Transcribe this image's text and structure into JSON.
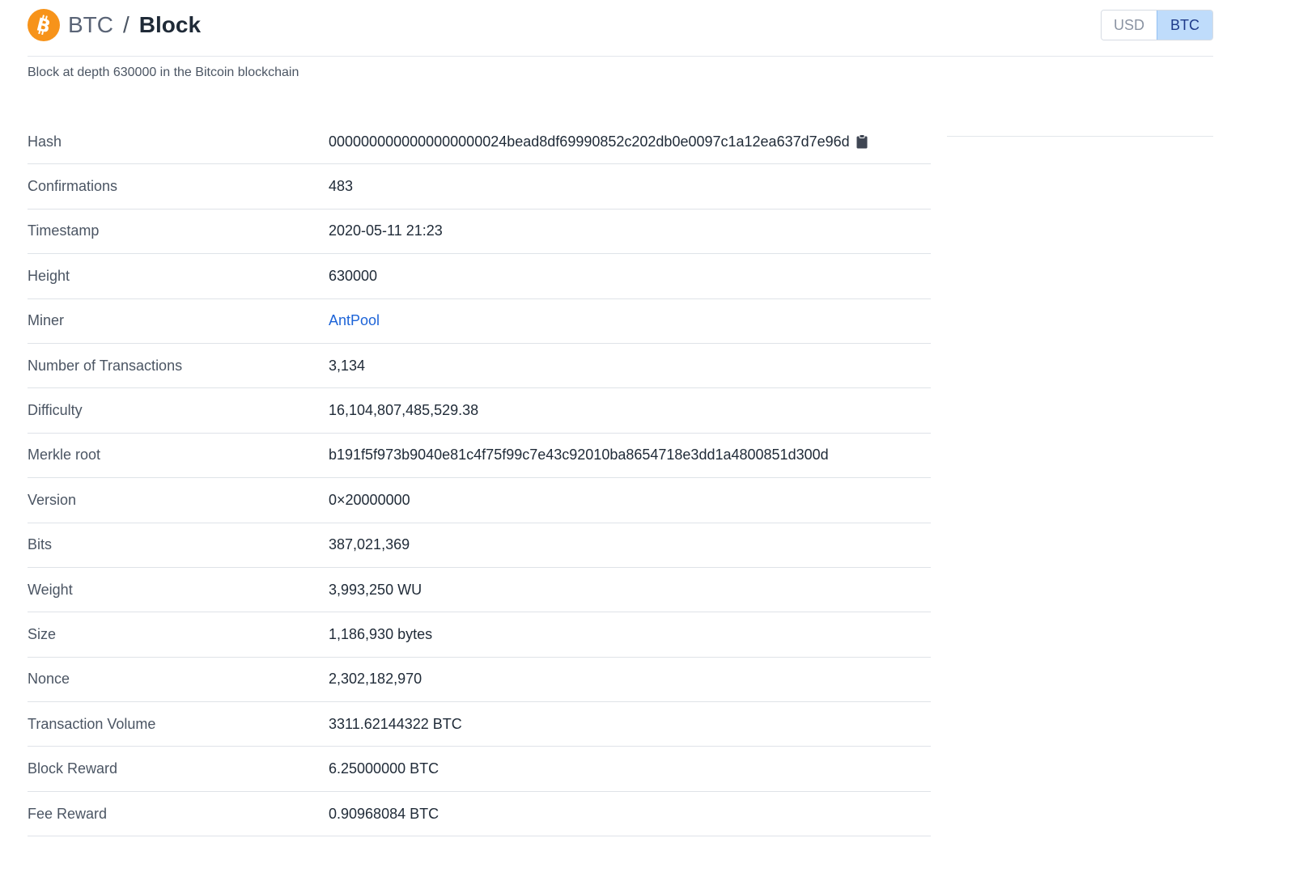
{
  "header": {
    "coin_icon": "bitcoin-icon",
    "coin_color": "#f7931a",
    "breadcrumb_coin": "BTC",
    "breadcrumb_separator": "/",
    "page_title": "Block"
  },
  "currency_toggle": {
    "options": [
      "USD",
      "BTC"
    ],
    "selected": "BTC"
  },
  "subtitle": "Block at depth 630000 in the Bitcoin blockchain",
  "block_details": [
    {
      "label": "Hash",
      "value": "0000000000000000000024bead8df69990852c202db0e0097c1a12ea637d7e96d",
      "icon": "clipboard-icon"
    },
    {
      "label": "Confirmations",
      "value": "483"
    },
    {
      "label": "Timestamp",
      "value": "2020-05-11 21:23"
    },
    {
      "label": "Height",
      "value": "630000"
    },
    {
      "label": "Miner",
      "value": "AntPool",
      "link_color": "#1d64d8"
    },
    {
      "label": "Number of Transactions",
      "value": "3,134"
    },
    {
      "label": "Difficulty",
      "value": "16,104,807,485,529.38"
    },
    {
      "label": "Merkle root",
      "value": "b191f5f973b9040e81c4f75f99c7e43c92010ba8654718e3dd1a4800851d300d"
    },
    {
      "label": "Version",
      "value": "0×20000000"
    },
    {
      "label": "Bits",
      "value": "387,021,369"
    },
    {
      "label": "Weight",
      "value": "3,993,250 WU"
    },
    {
      "label": "Size",
      "value": "1,186,930 bytes"
    },
    {
      "label": "Nonce",
      "value": "2,302,182,970"
    },
    {
      "label": "Transaction Volume",
      "value": "3311.62144322 BTC"
    },
    {
      "label": "Block Reward",
      "value": "6.25000000 BTC"
    },
    {
      "label": "Fee Reward",
      "value": "0.90968084 BTC"
    }
  ]
}
